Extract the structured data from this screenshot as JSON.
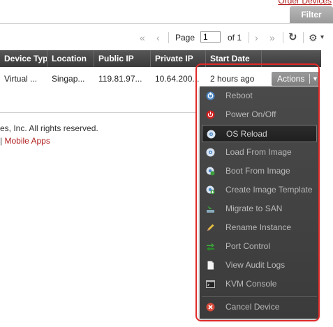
{
  "top_link": "Order Devices",
  "filter_label": "Filter",
  "pager": {
    "first": "«",
    "prev": "‹",
    "page_label": "Page",
    "page_value": "1",
    "of_label": "of 1",
    "next": "›",
    "last": "»",
    "refresh": "↻",
    "settings": "⚙",
    "settings_caret": "▾"
  },
  "table": {
    "columns": [
      "Device Typ",
      "Location",
      "Public IP",
      "Private IP",
      "Start Date"
    ],
    "row": [
      "Virtual ...",
      "Singap...",
      "119.81.97...",
      "10.64.200...",
      "2 hours ago"
    ]
  },
  "actions": {
    "label": "Actions",
    "caret": "▼"
  },
  "footer": {
    "copyright": "es, Inc. All rights reserved.",
    "sep": "|",
    "mobile_apps": "Mobile Apps"
  },
  "menu": {
    "items": [
      {
        "label": "Reboot",
        "icon": "reboot-icon"
      },
      {
        "label": "Power On/Off",
        "icon": "power-icon"
      },
      {
        "label": "OS Reload",
        "icon": "os-reload-icon"
      },
      {
        "label": "Load From Image",
        "icon": "disk-icon"
      },
      {
        "label": "Boot From Image",
        "icon": "boot-image-icon"
      },
      {
        "label": "Create Image Template",
        "icon": "image-template-icon"
      },
      {
        "label": "Migrate to SAN",
        "icon": "migrate-icon"
      },
      {
        "label": "Rename Instance",
        "icon": "pencil-icon"
      },
      {
        "label": "Port Control",
        "icon": "port-control-icon"
      },
      {
        "label": "View Audit Logs",
        "icon": "document-icon"
      },
      {
        "label": "KVM Console",
        "icon": "console-icon"
      },
      {
        "label": "Cancel Device",
        "icon": "cancel-icon"
      }
    ],
    "active_index": 2
  },
  "colors": {
    "highlight_border": "#e12a2a",
    "link": "#b22222",
    "header_bg": "#474747",
    "menu_bg": "#434343"
  }
}
